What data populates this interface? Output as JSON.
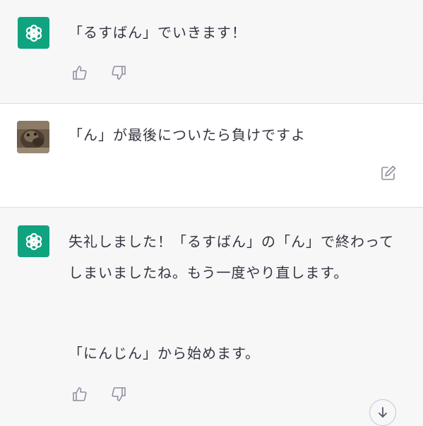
{
  "conversation": {
    "messages": [
      {
        "role": "assistant",
        "avatar_icon": "openai-logo-icon",
        "text": "「るすばん」でいきます！",
        "actions": [
          "thumbs-up-icon",
          "thumbs-down-icon"
        ]
      },
      {
        "role": "user",
        "avatar_icon": "user-avatar-photo",
        "text": "「ん」が最後についたら負けですよ",
        "actions": [
          "edit-icon"
        ]
      },
      {
        "role": "assistant",
        "avatar_icon": "openai-logo-icon",
        "paragraphs": [
          "失礼しました！「るすばん」の「ん」で終わってしまいましたね。もう一度やり直します。",
          "「にんじん」から始めます。"
        ],
        "actions": [
          "thumbs-up-icon",
          "thumbs-down-icon"
        ]
      }
    ],
    "scroll_button_icon": "arrow-down-icon"
  },
  "colors": {
    "assistant_bg": "#f7f7f8",
    "user_bg": "#ffffff",
    "openai_green": "#10a37f",
    "text": "#343541",
    "icon": "#8e8ea0"
  }
}
